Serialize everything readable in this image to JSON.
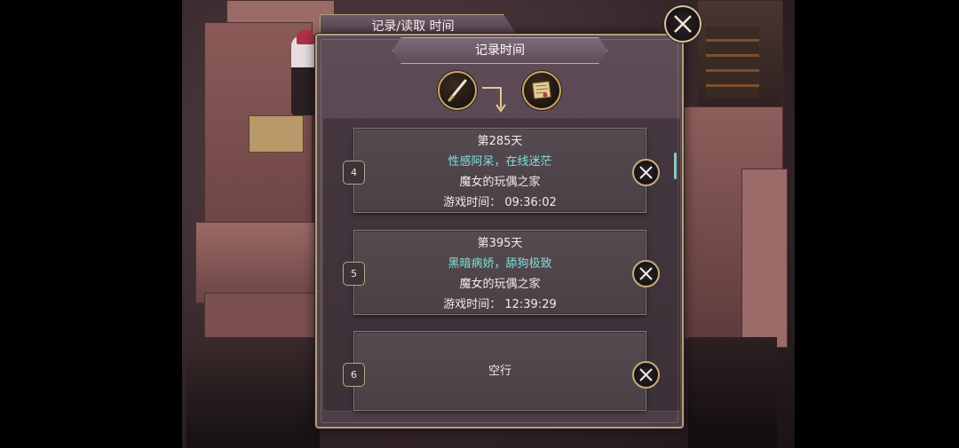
{
  "window": {
    "tab_title": "记录/读取 时间",
    "section_title": "记录时间"
  },
  "actions": {
    "save_icon": "quill-icon",
    "load_icon": "scroll-icon",
    "arrow_icon": "down-arrow-icon",
    "close_icon": "close-icon"
  },
  "slots": [
    {
      "number": "4",
      "day": "第285天",
      "title": "性感阿呆，在线迷茫",
      "location": "魔女的玩偶之家",
      "playtime": "游戏时间： 09:36:02",
      "empty": false
    },
    {
      "number": "5",
      "day": "第395天",
      "title": "黑暗病娇，舔狗极致",
      "location": "魔女的玩偶之家",
      "playtime": "游戏时间： 12:39:29",
      "empty": false
    },
    {
      "number": "6",
      "empty_label": "空行",
      "empty": true
    }
  ],
  "colors": {
    "accent_gold": "#c7a766",
    "title_teal": "#7fe0d8",
    "panel_bg": "#4d3e48"
  }
}
